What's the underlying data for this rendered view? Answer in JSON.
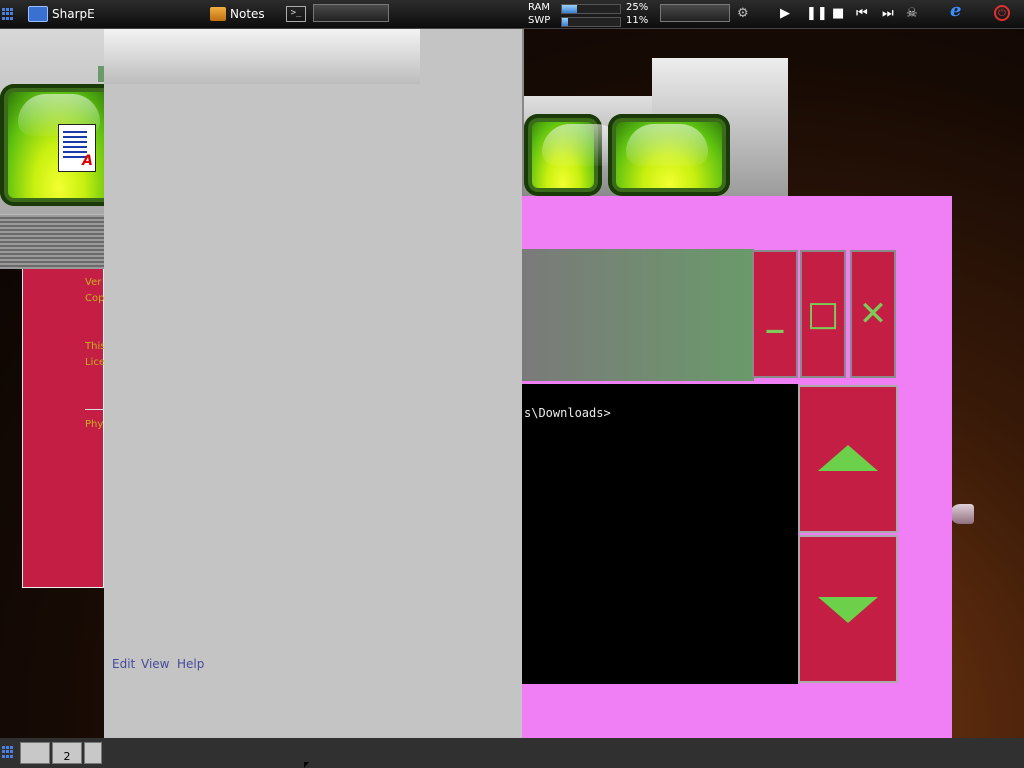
{
  "taskbar": {
    "app_menu_label": "SharpE",
    "notes_label": "Notes",
    "ram_label": "RAM",
    "ram_percent": "25%",
    "ram_value": 0.25,
    "swap_label": "SWP",
    "swap_percent": "11%",
    "swap_value": 0.11,
    "media_play": "▶",
    "media_pause": "❚❚",
    "media_stop": "■",
    "media_prev": "⏮",
    "media_next": "⏭"
  },
  "red_panel": {
    "line1": "Ver",
    "line2": "Cop",
    "line3": "This",
    "line4": "Lice",
    "line5": "Phy"
  },
  "gray_window": {
    "menu": [
      "Edit",
      "View",
      "Help"
    ]
  },
  "console": {
    "prompt_text": "s\\Downloads>",
    "minimize_glyph": "_",
    "maximize_glyph": "□",
    "close_glyph": "✕"
  },
  "bottom_bar": {
    "workspace_label": "2"
  },
  "colors": {
    "pink_frame": "#f07ef5",
    "crimson": "#c41e45",
    "green_accent": "#6cd04a",
    "orb_green": "#c8f010"
  },
  "icons": [
    "grid-icon",
    "monitor-icon",
    "notes-icon",
    "terminal-icon",
    "settings-icon",
    "bug-icon",
    "internet-explorer-icon",
    "power-icon",
    "document-icon",
    "arrow-up-icon",
    "arrow-down-icon"
  ]
}
